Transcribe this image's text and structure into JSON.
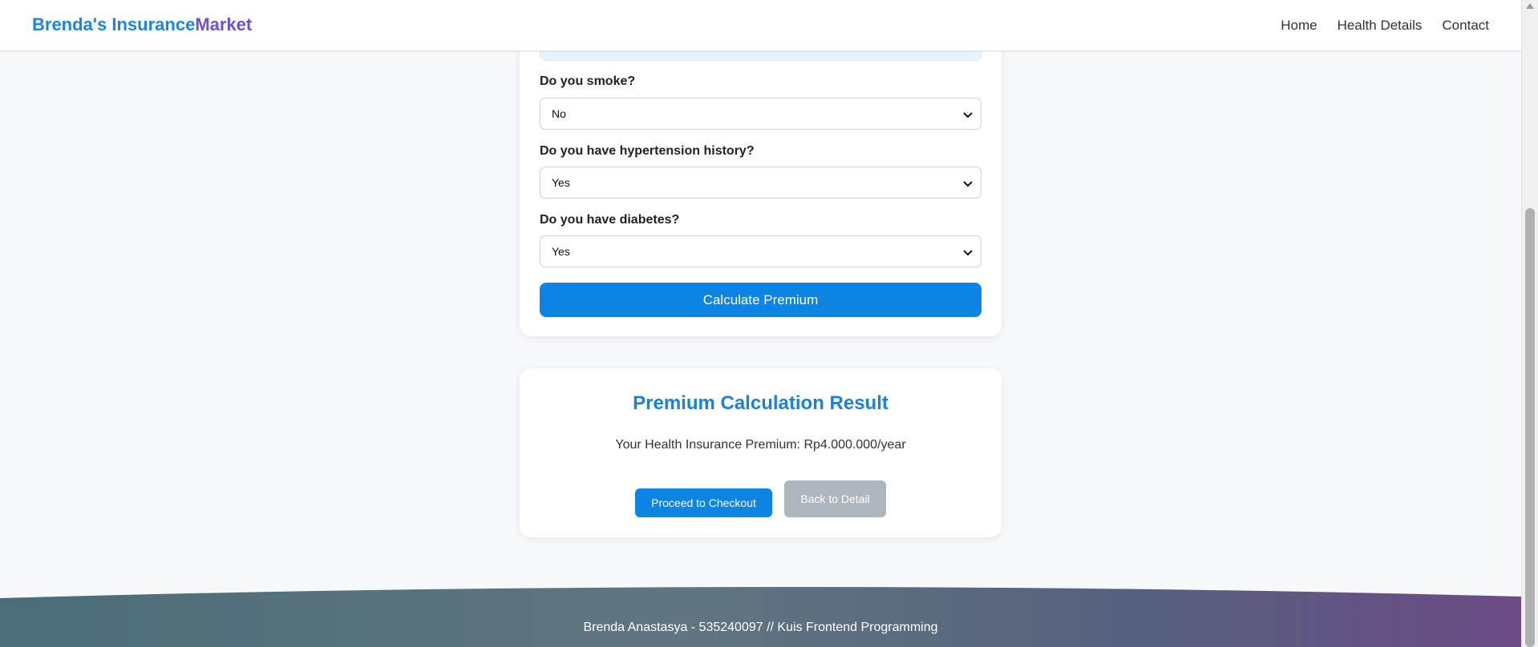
{
  "navbar": {
    "brand_part1": "Brenda's Insurance",
    "brand_part2": "Market",
    "links": [
      "Home",
      "Health Details",
      "Contact"
    ]
  },
  "form": {
    "smoke": {
      "label": "Do you smoke?",
      "value": "No"
    },
    "hypertension": {
      "label": "Do you have hypertension history?",
      "value": "Yes"
    },
    "diabetes": {
      "label": "Do you have diabetes?",
      "value": "Yes"
    },
    "submit_label": "Calculate Premium"
  },
  "result": {
    "title": "Premium Calculation Result",
    "text": "Your Health Insurance Premium: Rp4.000.000/year",
    "checkout_label": "Proceed to Checkout",
    "back_label": "Back to Detail"
  },
  "footer": {
    "text": "Brenda Anastasya - 535240097 // Kuis Frontend Programming"
  },
  "colors": {
    "primary": "#0b84e4",
    "brand_blue": "#1a85e3",
    "brand_purple": "#6f4fd8",
    "secondary_button": "#adb6bd",
    "footer_left": "#4a6d78",
    "footer_right": "#6a4e86"
  }
}
